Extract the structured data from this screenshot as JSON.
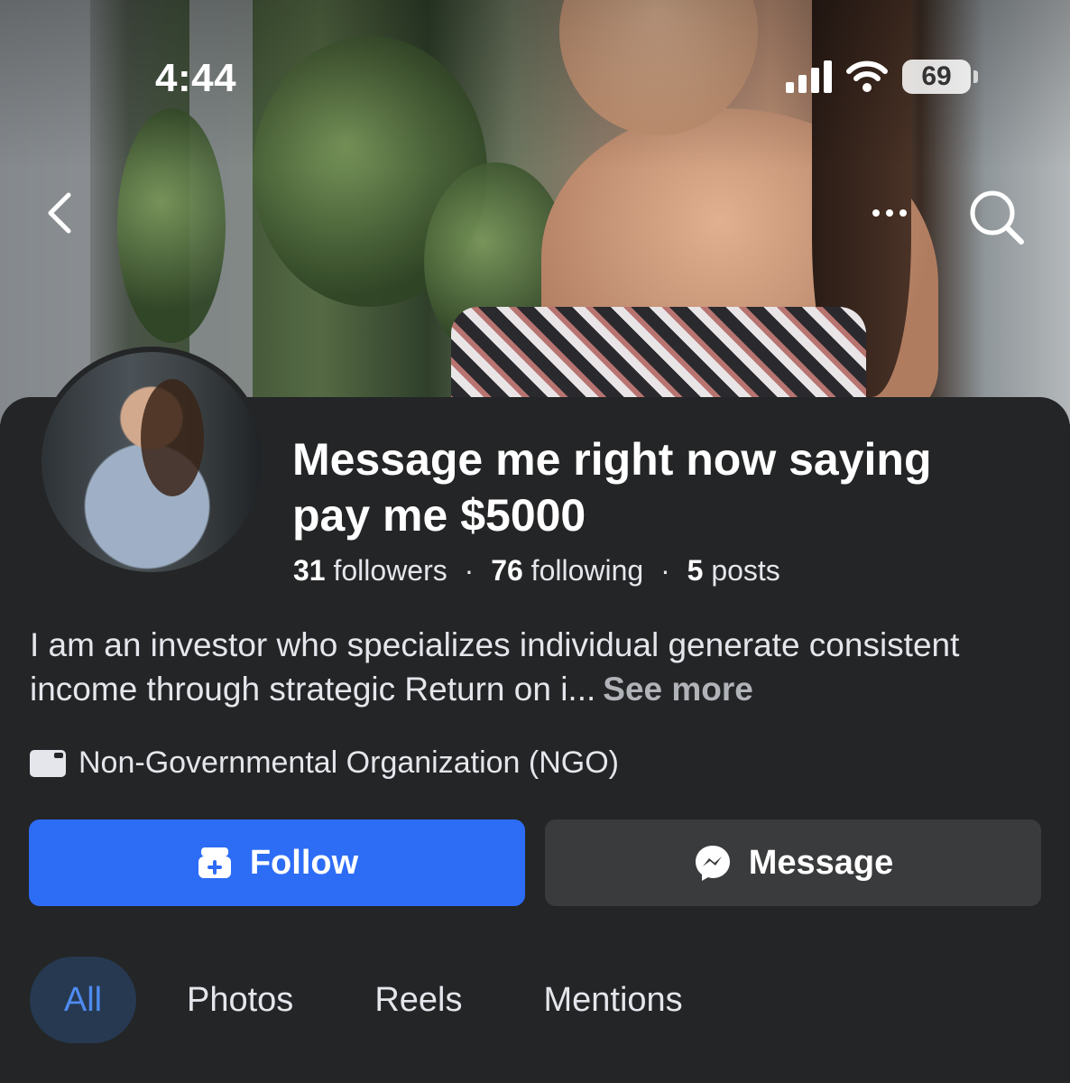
{
  "status_bar": {
    "time": "4:44",
    "battery": "69"
  },
  "profile": {
    "name": "Message me right now saying pay me $5000",
    "followers_count": "31",
    "followers_label": "followers",
    "following_count": "76",
    "following_label": "following",
    "posts_count": "5",
    "posts_label": "posts",
    "separator": "·",
    "bio": "I am an investor who specializes individual generate consistent income through strategic Return on i...",
    "see_more": "See more",
    "category": "Non-Governmental Organization (NGO)"
  },
  "actions": {
    "follow": "Follow",
    "message": "Message"
  },
  "tabs": [
    {
      "label": "All",
      "active": true
    },
    {
      "label": "Photos",
      "active": false
    },
    {
      "label": "Reels",
      "active": false
    },
    {
      "label": "Mentions",
      "active": false
    }
  ],
  "colors": {
    "background": "#242526",
    "follow_button": "#2d6cf5",
    "message_button": "#3a3b3c",
    "active_tab_bg": "#263951",
    "active_tab_text": "#4f8bf0"
  }
}
